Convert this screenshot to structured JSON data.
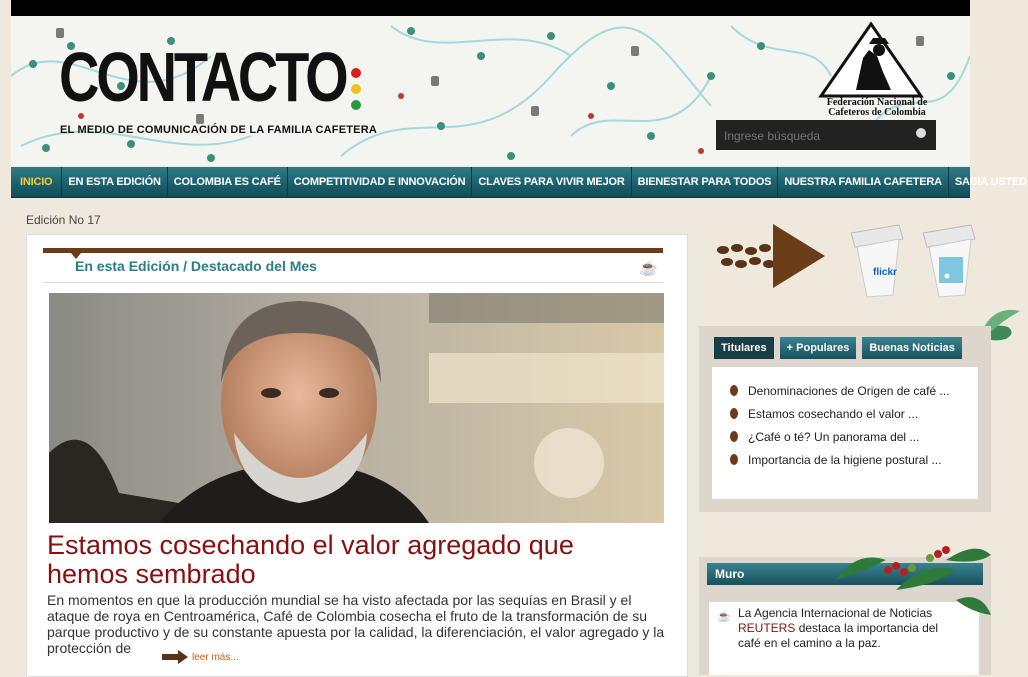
{
  "header": {
    "logo": "CONTACTO",
    "tagline": "EL MEDIO DE COMUNICACIÓN DE LA FAMILIA CAFETERA",
    "federation_line1": "Federación Nacional de",
    "federation_line2": "Cafeteros de Colombia",
    "search_placeholder": "Ingrese búsqueda"
  },
  "nav": {
    "items": [
      "INICIO",
      "EN ESTA EDICIÓN",
      "COLOMBIA ES CAFÉ",
      "COMPETITIVIDAD E INNOVACIÓN",
      "CLAVES PARA VIVIR MEJOR",
      "BIENESTAR PARA TODOS",
      "NUESTRA FAMILIA CAFETERA",
      "SABIA USTED QUE..."
    ],
    "active": 0
  },
  "edition": "Edición No 17",
  "feature": {
    "section_title": "En esta Edición / Destacado del Mes",
    "headline": "Estamos cosechando el valor agregado que hemos sembrado",
    "summary": "En momentos en que la producción mundial se ha visto afectada por las sequías en Brasil y el ataque de roya en Centroamérica, Café de Colombia cosecha el fruto de la transformación de su parque productivo y de su constante apuesta por la calidad, la diferenciación, el valor agregado y la protección de",
    "read_more": "leer más..."
  },
  "social": {
    "flickr_label": "flickr",
    "cup_icons": [
      "flickr-cup-icon",
      "rss-cup-icon"
    ]
  },
  "tabs": {
    "labels": [
      "Titulares",
      "+ Populares",
      "Buenas Noticias"
    ],
    "active": 0,
    "items": [
      "Denominaciones de Origen de café ...",
      "Estamos cosechando el valor ...",
      "¿Café o té? Un panorama del ...",
      "Importancia de la higiene postural ..."
    ]
  },
  "muro": {
    "title": "Muro",
    "text_before": "La Agencia Internacional de Noticias",
    "highlight": "REUTERS",
    "text_after": "destaca la importancia del café en el camino a la paz."
  },
  "colors": {
    "nav_bg": "#1f6470",
    "nav_active_text": "#f6cf2c",
    "headline": "#8a1010",
    "section_title": "#2a7d8a",
    "coffee_brown": "#6a3c17"
  }
}
